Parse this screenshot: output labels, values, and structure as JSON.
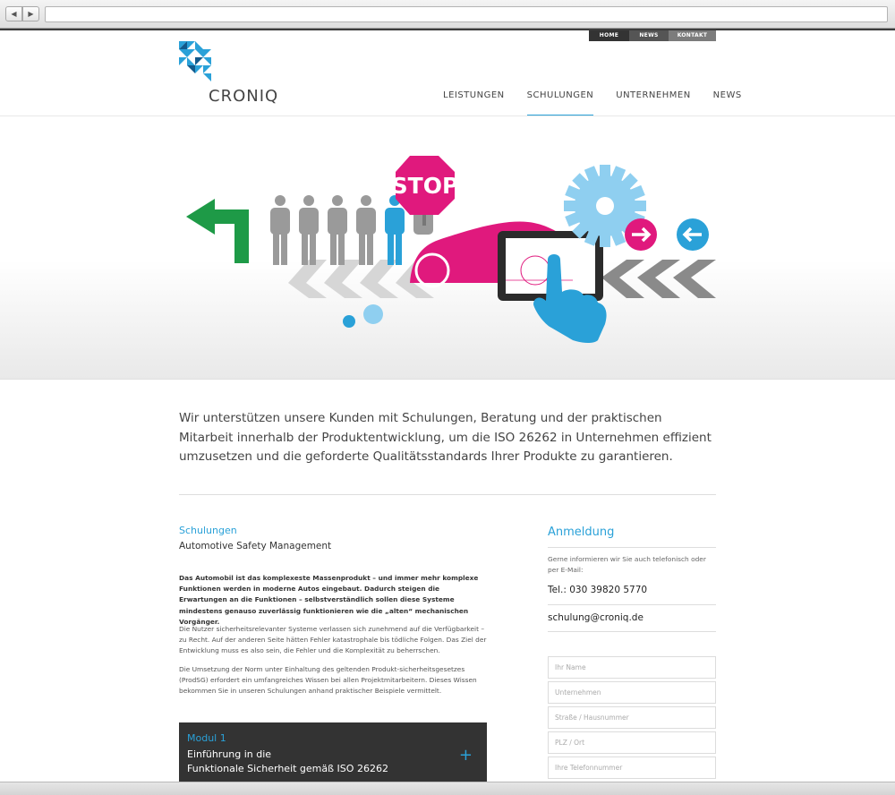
{
  "topnav": {
    "home": "HOME",
    "news": "NEWS",
    "kontakt": "KONTAKT"
  },
  "brand": {
    "name": "CRONIQ"
  },
  "mainnav": [
    {
      "label": "LEISTUNGEN"
    },
    {
      "label": "SCHULUNGEN",
      "active": true
    },
    {
      "label": "UNTERNEHMEN"
    },
    {
      "label": "NEWS"
    }
  ],
  "hero": {
    "sign_text": "STOP"
  },
  "intro": "Wir unterstützen unsere Kunden mit Schulungen, Beratung und der praktischen Mitarbeit innerhalb der Produktentwicklung, um die ISO 26262 in Unternehmen effizient umzusetzen und die geforderte Qualitätsstandards Ihrer Produkte zu garantieren.",
  "section": {
    "title": "Schulungen",
    "subtitle": "Automotive Safety Management",
    "paragraphs": [
      "Das Automobil ist das komplexeste Massenprodukt – und immer mehr komplexe Funktionen werden in moderne Autos eingebaut. Dadurch steigen die Erwartungen an die Funktionen – selbstverständlich sollen diese Systeme mindestens genauso zuverlässig funktionieren wie die „alten“ mechanischen Vorgänger.",
      "Die Nutzer sicherheitsrelevanter Systeme verlassen sich zunehmend auf die Verfügbarkeit – zu Recht. Auf der anderen Seite hätten Fehler katastrophale bis tödliche Folgen. Das Ziel der Entwicklung muss es also sein, die Fehler und die Komplexität zu beherrschen.",
      "Die Umsetzung der Norm unter Einhaltung des geltenden Produkt-sicherheitsgesetzes (ProdSG) erfordert ein umfangreiches Wissen bei allen Projektmitarbeitern. Dieses Wissen bekommen Sie in unseren Schulungen anhand praktischer Beispiele vermittelt."
    ]
  },
  "module": {
    "label": "Modul 1",
    "title_line1": "Einführung in die",
    "title_line2": "Funktionale Sicherheit gemäß ISO 26262",
    "toggle": "+"
  },
  "registration": {
    "title": "Anmeldung",
    "note": "Gerne informieren wir Sie auch telefonisch oder per E-Mail:",
    "tel": "Tel.: 030 39820 5770",
    "email": "schulung@croniq.de",
    "fields": {
      "name": "Ihr Name",
      "company": "Unternehmen",
      "street": "Straße / Hausnummer",
      "city": "PLZ / Ort",
      "phone": "Ihre Telefonnummer"
    }
  },
  "colors": {
    "accent_blue": "#2aa1d8",
    "magenta": "#e0197d",
    "green": "#1e9a47",
    "grey_figures": "#9a9a9a"
  }
}
